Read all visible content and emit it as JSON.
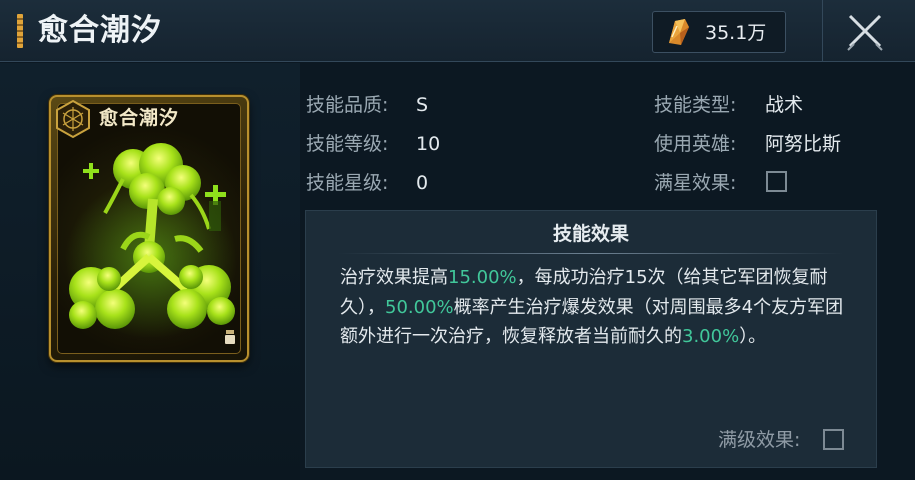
{
  "header": {
    "title": "愈合潮汐",
    "currency_value": "35.1万"
  },
  "card": {
    "title": "愈合潮汐"
  },
  "info": {
    "quality_label": "技能品质:",
    "quality_value": "S",
    "level_label": "技能等级:",
    "level_value": "10",
    "star_label": "技能星级:",
    "star_value": "0",
    "type_label": "技能类型:",
    "type_value": "战术",
    "hero_label": "使用英雄:",
    "hero_value": "阿努比斯",
    "fullstar_label": "满星效果:"
  },
  "effect": {
    "title": "技能效果",
    "parts": {
      "p1": "治疗效果提高",
      "h1": "15.00%",
      "p2": "，每成功治疗15次（给其它军团恢复耐久），",
      "h2": "50.00%",
      "p3": "概率产生治疗爆发效果（对周围最多4个友方军团额外进行一次治疗，恢复释放者当前耐久的",
      "h3": "3.00%",
      "p4": "）。"
    },
    "maxlevel_label": "满级效果:"
  },
  "colors": {
    "highlight": "#41c79a",
    "card_border": "#b8902e",
    "accent": "#e0a43a"
  },
  "icons": {
    "currency": "crystal-icon",
    "close": "close-x-icon",
    "card_emblem": "hexagon-emblem-icon"
  }
}
